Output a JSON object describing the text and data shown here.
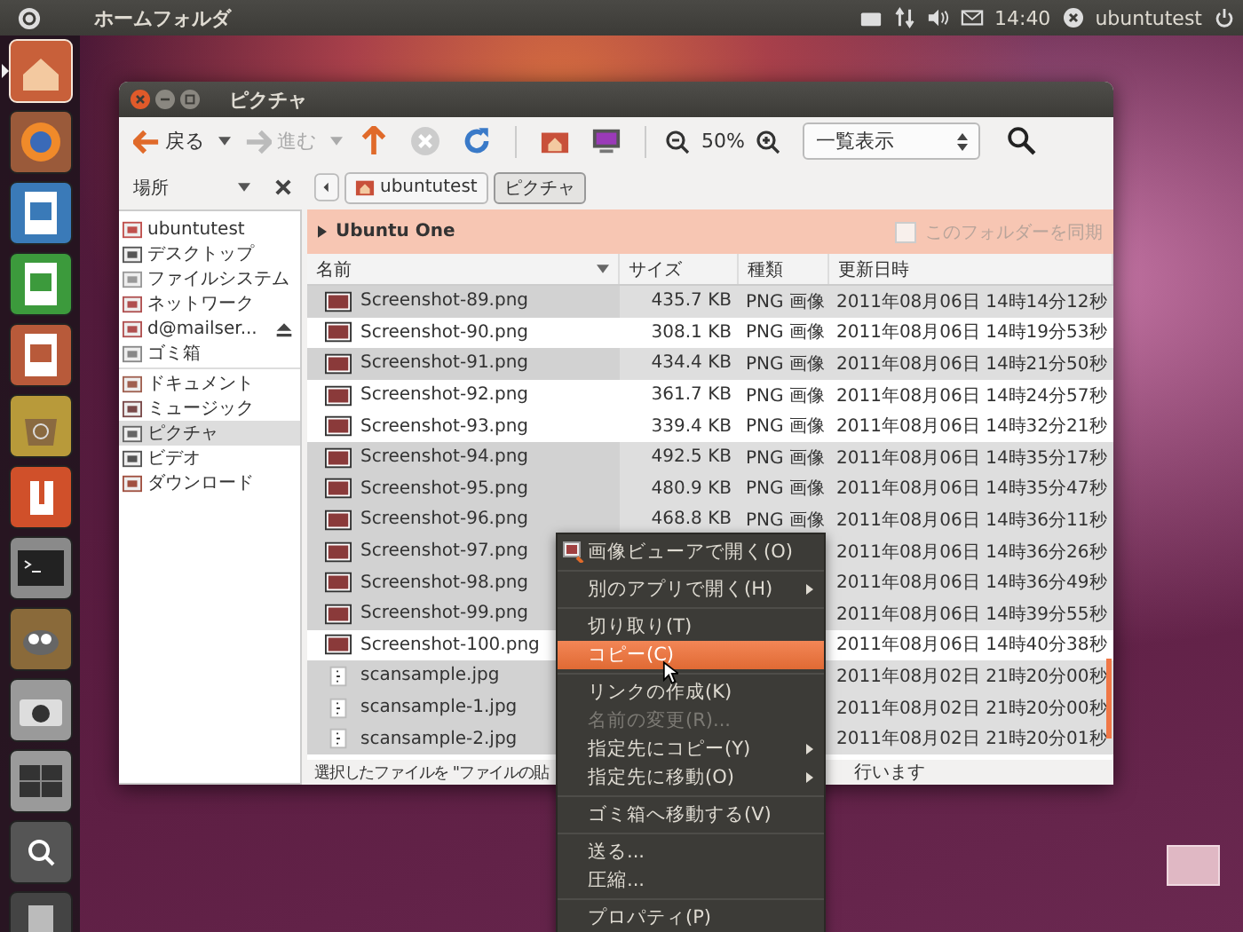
{
  "top_panel": {
    "title": "ホームフォルダ",
    "clock": "14:40",
    "user": "ubuntutest"
  },
  "launcher": [
    {
      "kind": "home",
      "selected": true
    },
    {
      "kind": "browser",
      "selected": false
    },
    {
      "kind": "writer",
      "selected": false
    },
    {
      "kind": "calc",
      "selected": false
    },
    {
      "kind": "impress",
      "selected": false
    },
    {
      "kind": "software",
      "selected": false
    },
    {
      "kind": "cloud",
      "selected": false
    },
    {
      "kind": "terminal",
      "selected": false
    },
    {
      "kind": "gimp",
      "selected": false
    },
    {
      "kind": "camera",
      "selected": false
    },
    {
      "kind": "workspaces",
      "selected": false
    },
    {
      "kind": "zoom",
      "selected": false
    },
    {
      "kind": "trash",
      "selected": false
    }
  ],
  "window": {
    "title": "ピクチャ"
  },
  "toolbar": {
    "back": "戻る",
    "forward": "進む",
    "forward_disabled": true,
    "zoom": "50%",
    "view": "一覧表示"
  },
  "sidebar": {
    "header": "場所",
    "groups": [
      [
        {
          "label": "ubuntutest",
          "kind": "home",
          "selected": false
        },
        {
          "label": "デスクトップ",
          "kind": "desktop",
          "selected": false
        },
        {
          "label": "ファイルシステム",
          "kind": "drive",
          "selected": false
        },
        {
          "label": "ネットワーク",
          "kind": "network",
          "selected": false
        },
        {
          "label": "d@mailser...",
          "kind": "mount",
          "selected": false
        },
        {
          "label": "ゴミ箱",
          "kind": "trash",
          "selected": false
        }
      ],
      [
        {
          "label": "ドキュメント",
          "kind": "folder",
          "selected": false
        },
        {
          "label": "ミュージック",
          "kind": "music",
          "selected": false
        },
        {
          "label": "ピクチャ",
          "kind": "pictures",
          "selected": true
        },
        {
          "label": "ビデオ",
          "kind": "video",
          "selected": false
        },
        {
          "label": "ダウンロード",
          "kind": "download",
          "selected": false
        }
      ]
    ]
  },
  "breadcrumb": [
    {
      "label": "ubuntutest",
      "selected": false,
      "home": true
    },
    {
      "label": "ピクチャ",
      "selected": true,
      "home": false
    }
  ],
  "ubuntu_one": {
    "label": "Ubuntu One",
    "sync_label": "このフォルダーを同期",
    "checked": false,
    "disabled": true
  },
  "table": {
    "columns": [
      {
        "label": "名前",
        "sorted": true
      },
      {
        "label": "サイズ",
        "sorted": false
      },
      {
        "label": "種類",
        "sorted": false
      },
      {
        "label": "更新日時",
        "sorted": false
      }
    ],
    "rows": [
      {
        "name": "Screenshot-89.png",
        "kind": "png",
        "size": "435.7 KB",
        "type": "PNG 画像",
        "modified": "2011年08月06日 14時14分12秒",
        "selected": true
      },
      {
        "name": "Screenshot-90.png",
        "kind": "png",
        "size": "308.1 KB",
        "type": "PNG 画像",
        "modified": "2011年08月06日 14時19分53秒",
        "selected": false
      },
      {
        "name": "Screenshot-91.png",
        "kind": "png",
        "size": "434.4 KB",
        "type": "PNG 画像",
        "modified": "2011年08月06日 14時21分50秒",
        "selected": true
      },
      {
        "name": "Screenshot-92.png",
        "kind": "png",
        "size": "361.7 KB",
        "type": "PNG 画像",
        "modified": "2011年08月06日 14時24分57秒",
        "selected": false
      },
      {
        "name": "Screenshot-93.png",
        "kind": "png",
        "size": "339.4 KB",
        "type": "PNG 画像",
        "modified": "2011年08月06日 14時32分21秒",
        "selected": false
      },
      {
        "name": "Screenshot-94.png",
        "kind": "png",
        "size": "492.5 KB",
        "type": "PNG 画像",
        "modified": "2011年08月06日 14時35分17秒",
        "selected": true
      },
      {
        "name": "Screenshot-95.png",
        "kind": "png",
        "size": "480.9 KB",
        "type": "PNG 画像",
        "modified": "2011年08月06日 14時35分47秒",
        "selected": true
      },
      {
        "name": "Screenshot-96.png",
        "kind": "png",
        "size": "468.8 KB",
        "type": "PNG 画像",
        "modified": "2011年08月06日 14時36分11秒",
        "selected": true
      },
      {
        "name": "Screenshot-97.png",
        "kind": "png",
        "modified": "2011年08月06日 14時36分26秒",
        "selected": true
      },
      {
        "name": "Screenshot-98.png",
        "kind": "png",
        "modified": "2011年08月06日 14時36分49秒",
        "selected": true
      },
      {
        "name": "Screenshot-99.png",
        "kind": "png",
        "modified": "2011年08月06日 14時39分55秒",
        "selected": true
      },
      {
        "name": "Screenshot-100.png",
        "kind": "png",
        "modified": "2011年08月06日 14時40分38秒",
        "selected": false
      },
      {
        "name": "scansample.jpg",
        "kind": "jpg",
        "modified": "2011年08月02日 21時20分00秒",
        "selected": true
      },
      {
        "name": "scansample-1.jpg",
        "kind": "jpg",
        "modified": "2011年08月02日 21時20分00秒",
        "selected": true
      },
      {
        "name": "scansample-2.jpg",
        "kind": "jpg",
        "modified": "2011年08月02日 21時20分01秒",
        "selected": true
      }
    ]
  },
  "status_bar": {
    "left": "選択したファイルを \"ファイルの貼",
    "right": "行います"
  },
  "context_menu": [
    {
      "kind": "item",
      "label": "画像ビューアで開く(O)",
      "icon": true,
      "submenu": false,
      "disabled": false,
      "selected": false
    },
    {
      "kind": "separator"
    },
    {
      "kind": "item",
      "label": "別のアプリで開く(H)",
      "icon": false,
      "submenu": true,
      "disabled": false,
      "selected": false
    },
    {
      "kind": "separator"
    },
    {
      "kind": "item",
      "label": "切り取り(T)",
      "icon": false,
      "submenu": false,
      "disabled": false,
      "selected": false
    },
    {
      "kind": "item",
      "label": "コピー(C)",
      "icon": false,
      "submenu": false,
      "disabled": false,
      "selected": true
    },
    {
      "kind": "separator"
    },
    {
      "kind": "item",
      "label": "リンクの作成(K)",
      "icon": false,
      "submenu": false,
      "disabled": false,
      "selected": false
    },
    {
      "kind": "item",
      "label": "名前の変更(R)...",
      "icon": false,
      "submenu": false,
      "disabled": true,
      "selected": false
    },
    {
      "kind": "item",
      "label": "指定先にコピー(Y)",
      "icon": false,
      "submenu": true,
      "disabled": false,
      "selected": false
    },
    {
      "kind": "item",
      "label": "指定先に移動(O)",
      "icon": false,
      "submenu": true,
      "disabled": false,
      "selected": false
    },
    {
      "kind": "separator"
    },
    {
      "kind": "item",
      "label": "ゴミ箱へ移動する(V)",
      "icon": false,
      "submenu": false,
      "disabled": false,
      "selected": false
    },
    {
      "kind": "separator"
    },
    {
      "kind": "item",
      "label": "送る...",
      "icon": false,
      "submenu": false,
      "disabled": false,
      "selected": false
    },
    {
      "kind": "item",
      "label": "圧縮...",
      "icon": false,
      "submenu": false,
      "disabled": false,
      "selected": false
    },
    {
      "kind": "separator"
    },
    {
      "kind": "item",
      "label": "プロパティ(P)",
      "icon": false,
      "submenu": false,
      "disabled": false,
      "selected": false
    }
  ]
}
